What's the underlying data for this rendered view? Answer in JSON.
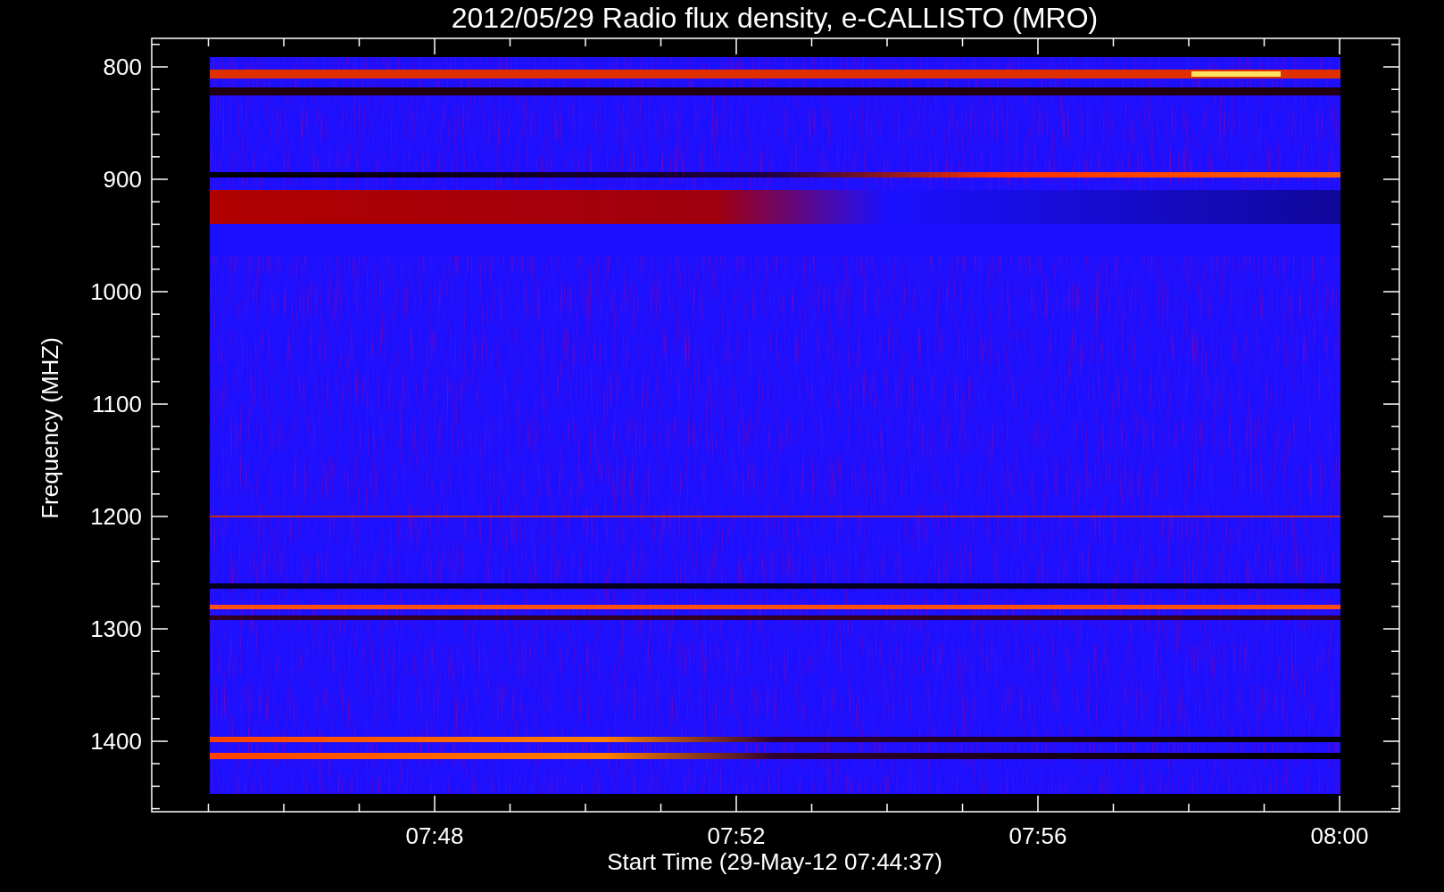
{
  "title": "2012/05/29  Radio flux density, e-CALLISTO (MRO)",
  "ylabel": "Frequency (MHZ)",
  "xlabel": "Start Time (29-May-12 07:44:37)",
  "yticks": [
    "800",
    "900",
    "1000",
    "1100",
    "1200",
    "1300",
    "1400"
  ],
  "xticks": [
    "07:48",
    "07:52",
    "07:56",
    "08:00"
  ]
}
